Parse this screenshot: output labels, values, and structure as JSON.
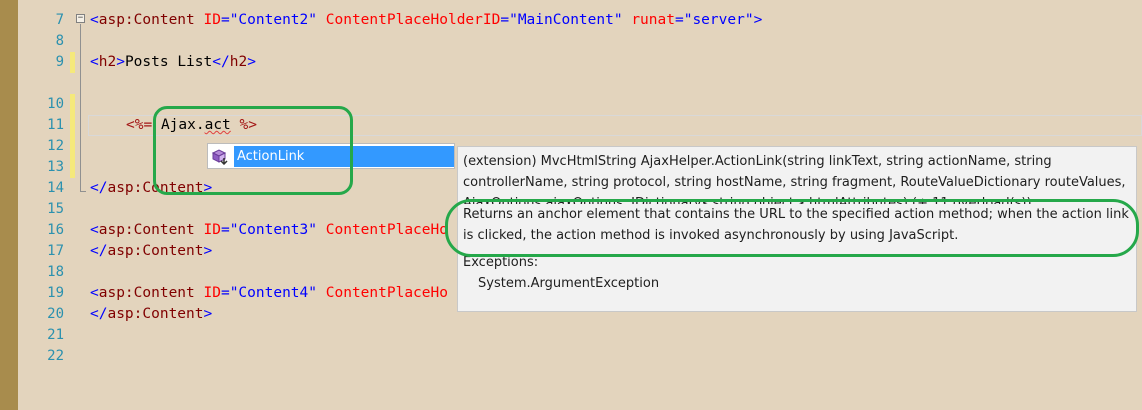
{
  "editor": {
    "lines": [
      {
        "num": "7"
      },
      {
        "num": "8"
      },
      {
        "num": "9"
      },
      {
        "num": "10"
      },
      {
        "num": "11"
      },
      {
        "num": "12"
      },
      {
        "num": "13"
      },
      {
        "num": "14"
      },
      {
        "num": "15"
      },
      {
        "num": "16"
      },
      {
        "num": "17"
      },
      {
        "num": "18"
      },
      {
        "num": "19"
      },
      {
        "num": "20"
      },
      {
        "num": "21"
      },
      {
        "num": "22"
      }
    ],
    "code": {
      "l7": {
        "lt": "<",
        "tag": "asp:Content",
        "a1": "ID",
        "eq": "=",
        "v1": "\"Content2\"",
        "a2": "ContentPlaceHolderID",
        "v2": "\"MainContent\"",
        "a3": "runat",
        "v3": "\"server\"",
        "gt": ">"
      },
      "l9": {
        "lt": "<",
        "tag": "h2",
        "gt": ">",
        "text": "Posts List",
        "lt2": "</",
        "tag2": "h2",
        "gt2": ">"
      },
      "l12": {
        "open": "<%=",
        "obj": "Ajax",
        "dot": ".",
        "typed": "act",
        "close": "%>"
      },
      "l15": {
        "lt": "</",
        "tag": "asp:Content",
        "gt": ">"
      },
      "l17": {
        "lt": "<",
        "tag": "asp:Content",
        "a1": "ID",
        "eq": "=",
        "v1": "\"Content3\"",
        "a2": "ContentPlaceHo"
      },
      "l18": {
        "lt": "</",
        "tag": "asp:Content",
        "gt": ">"
      },
      "l20": {
        "lt": "<",
        "tag": "asp:Content",
        "a1": "ID",
        "eq": "=",
        "v1": "\"Content4\"",
        "a2": "ContentPlaceHo"
      },
      "l21": {
        "lt": "</",
        "tag": "asp:Content",
        "gt": ">"
      }
    }
  },
  "intellisense": {
    "item_label": "ActionLink",
    "item_icon": "extension-method-icon"
  },
  "tooltip": {
    "signature_1": "(extension) MvcHtmlString AjaxHelper.ActionLink(string linkText, string actionName, string",
    "signature_2": "controllerName, string protocol, string hostName, string fragment, RouteValueDictionary routeValues,",
    "signature_3": "AjaxOptions ajaxOptions, IDictionary<string,object> htmlAttributes)  (+ 11 overload(s))",
    "description_1": "Returns an anchor element that contains the URL to the specified action method; when the action link",
    "description_2": "is clicked, the action method is invoked asynchronously by using JavaScript.",
    "exceptions_header": "Exceptions:",
    "exception_1": "System.ArgumentException"
  },
  "colors": {
    "editor_bg": "#e3d4bd",
    "gutter_bar": "#a88c4d",
    "line_number": "#2b91af",
    "highlight": "#25a84a",
    "selection": "#3399ff"
  }
}
